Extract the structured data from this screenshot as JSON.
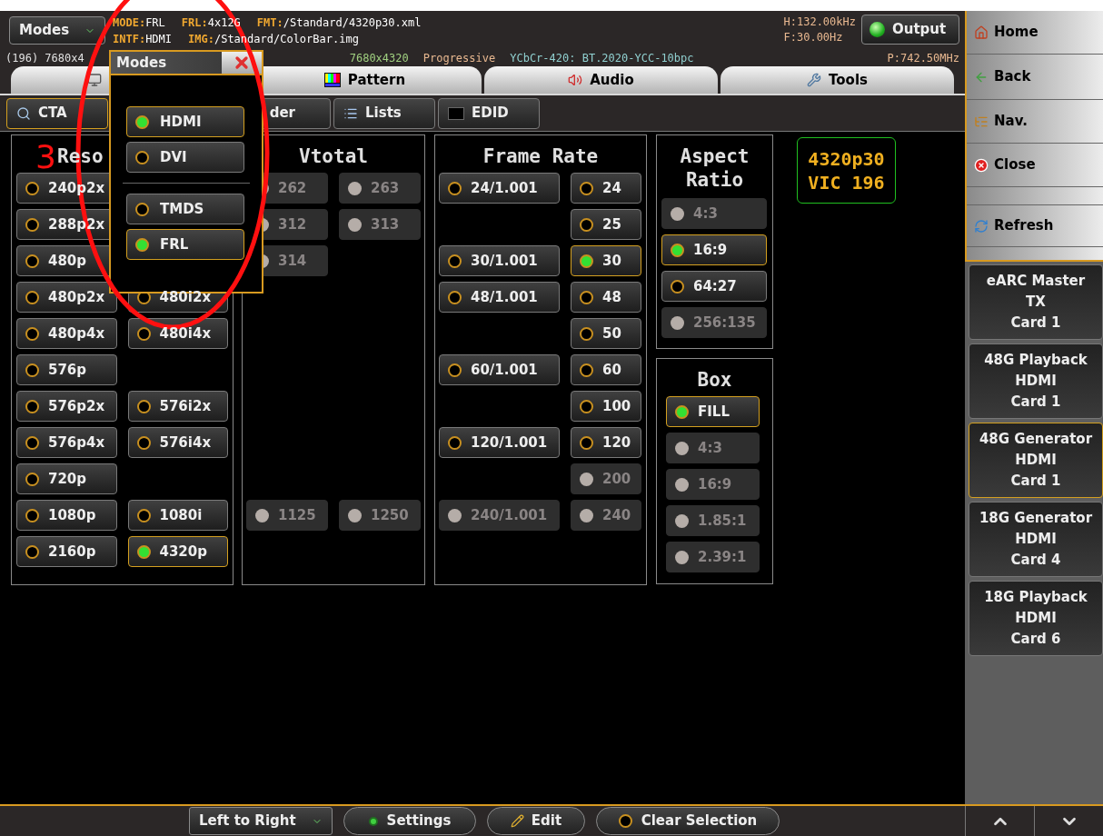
{
  "header": {
    "modes_button": "Modes",
    "info_lines": [
      [
        {
          "label": "MODE:",
          "value": "FRL"
        },
        {
          "label": "FRL:",
          "value": "4x12G"
        },
        {
          "label": "FMT:",
          "value": "/Standard/4320p30.xml"
        }
      ],
      [
        {
          "label": "INTF:",
          "value": "HDMI"
        },
        {
          "label": "IMG:",
          "value": "/Standard/ColorBar.img"
        }
      ]
    ],
    "timing": [
      "H:132.00kHz",
      "F:30.00Hz"
    ],
    "output_button": "Output",
    "mode_cut": "(196) 7680x4",
    "format_line": [
      {
        "text": "7680x4320",
        "color": "#a0d080"
      },
      {
        "text": "Progressive",
        "color": "#e8b890"
      },
      {
        "text": "YCbCr-420: BT.2020-YCC-10bpc",
        "color": "#90d0d0"
      }
    ],
    "pixel_clock": "P:742.50MHz"
  },
  "tabs": [
    {
      "kind": "display"
    },
    {
      "kind": "pattern",
      "label": "Pattern"
    },
    {
      "kind": "audio",
      "label": "Audio"
    },
    {
      "kind": "tools",
      "label": "Tools"
    }
  ],
  "subtabs": [
    {
      "kind": "cta",
      "label": "CTA",
      "selected": true
    },
    {
      "kind": "plain",
      "label": "der",
      "selected": false
    },
    {
      "kind": "lists",
      "label": "Lists",
      "selected": false
    },
    {
      "kind": "edid",
      "label": "EDID",
      "selected": false
    }
  ],
  "panels": [
    {
      "title": "Reso",
      "rows": [
        [
          {
            "label": "240p2x",
            "selected": false,
            "disabled": false
          },
          null
        ],
        [
          {
            "label": "288p2x",
            "selected": false,
            "disabled": false
          },
          null
        ],
        [
          {
            "label": "480p",
            "selected": false,
            "disabled": false
          },
          null
        ],
        [
          {
            "label": "480p2x",
            "selected": false,
            "disabled": false
          },
          {
            "label": "480i2x",
            "selected": false,
            "disabled": false
          }
        ],
        [
          {
            "label": "480p4x",
            "selected": false,
            "disabled": false
          },
          {
            "label": "480i4x",
            "selected": false,
            "disabled": false
          }
        ],
        [
          {
            "label": "576p",
            "selected": false,
            "disabled": false
          },
          null
        ],
        [
          {
            "label": "576p2x",
            "selected": false,
            "disabled": false
          },
          {
            "label": "576i2x",
            "selected": false,
            "disabled": false
          }
        ],
        [
          {
            "label": "576p4x",
            "selected": false,
            "disabled": false
          },
          {
            "label": "576i4x",
            "selected": false,
            "disabled": false
          }
        ],
        [
          {
            "label": "720p",
            "selected": false,
            "disabled": false
          },
          null
        ],
        [
          {
            "label": "1080p",
            "selected": false,
            "disabled": false
          },
          {
            "label": "1080i",
            "selected": false,
            "disabled": false
          }
        ],
        [
          {
            "label": "2160p",
            "selected": false,
            "disabled": false
          },
          {
            "label": "4320p",
            "selected": true,
            "disabled": false
          }
        ]
      ]
    },
    {
      "title": "Vtotal",
      "rows": [
        [
          {
            "label": "262",
            "selected": false,
            "disabled": true
          },
          {
            "label": "263",
            "selected": false,
            "disabled": true
          }
        ],
        [
          {
            "label": "312",
            "selected": false,
            "disabled": true
          },
          {
            "label": "313",
            "selected": false,
            "disabled": true
          }
        ],
        [
          {
            "label": "314",
            "selected": false,
            "disabled": true
          },
          null
        ],
        [
          null,
          null
        ],
        [
          null,
          null
        ],
        [
          null,
          null
        ],
        [
          null,
          null
        ],
        [
          null,
          null
        ],
        [
          null,
          null
        ],
        [
          {
            "label": "1125",
            "selected": false,
            "disabled": true
          },
          {
            "label": "1250",
            "selected": false,
            "disabled": true
          }
        ]
      ]
    },
    {
      "title": "Frame Rate",
      "rows": [
        [
          {
            "label": "24/1.001",
            "selected": false,
            "disabled": false
          },
          {
            "label": "24",
            "selected": false,
            "disabled": false
          }
        ],
        [
          null,
          {
            "label": "25",
            "selected": false,
            "disabled": false
          }
        ],
        [
          {
            "label": "30/1.001",
            "selected": false,
            "disabled": false
          },
          {
            "label": "30",
            "selected": true,
            "disabled": false
          }
        ],
        [
          {
            "label": "48/1.001",
            "selected": false,
            "disabled": false
          },
          {
            "label": "48",
            "selected": false,
            "disabled": false
          }
        ],
        [
          null,
          {
            "label": "50",
            "selected": false,
            "disabled": false
          }
        ],
        [
          {
            "label": "60/1.001",
            "selected": false,
            "disabled": false
          },
          {
            "label": "60",
            "selected": false,
            "disabled": false
          }
        ],
        [
          null,
          {
            "label": "100",
            "selected": false,
            "disabled": false
          }
        ],
        [
          {
            "label": "120/1.001",
            "selected": false,
            "disabled": false
          },
          {
            "label": "120",
            "selected": false,
            "disabled": false
          }
        ],
        [
          null,
          {
            "label": "200",
            "selected": false,
            "disabled": true
          }
        ],
        [
          {
            "label": "240/1.001",
            "selected": false,
            "disabled": true
          },
          {
            "label": "240",
            "selected": false,
            "disabled": true
          }
        ]
      ]
    },
    {
      "title": "Aspect Ratio",
      "rows": [
        [
          {
            "label": "4:3",
            "selected": false,
            "disabled": true
          }
        ],
        [
          {
            "label": "16:9",
            "selected": true,
            "disabled": false
          }
        ],
        [
          {
            "label": "64:27",
            "selected": false,
            "disabled": false
          }
        ],
        [
          {
            "label": "256:135",
            "selected": false,
            "disabled": true
          }
        ]
      ]
    },
    {
      "title": "Box",
      "rows": [
        [
          {
            "label": "FILL",
            "selected": true,
            "disabled": false
          }
        ],
        [
          {
            "label": "4:3",
            "selected": false,
            "disabled": true
          }
        ],
        [
          {
            "label": "16:9",
            "selected": false,
            "disabled": true
          }
        ],
        [
          {
            "label": "1.85:1",
            "selected": false,
            "disabled": true
          }
        ],
        [
          {
            "label": "2.39:1",
            "selected": false,
            "disabled": true
          }
        ]
      ]
    }
  ],
  "vic_badge": [
    "4320p30",
    "VIC 196"
  ],
  "modes_popup": {
    "title": "Modes",
    "groups": [
      [
        {
          "label": "HDMI",
          "selected": true
        },
        {
          "label": "DVI",
          "selected": false
        }
      ],
      [
        {
          "label": "TMDS",
          "selected": false
        },
        {
          "label": "FRL",
          "selected": true
        }
      ]
    ]
  },
  "annotation": {
    "label": "3"
  },
  "sidebar": {
    "nav": [
      {
        "kind": "home",
        "label": "Home"
      },
      {
        "kind": "back",
        "label": "Back"
      },
      {
        "kind": "nav",
        "label": "Nav."
      },
      {
        "kind": "close",
        "label": "Close"
      },
      {
        "kind": "refresh",
        "label": "Refresh"
      }
    ],
    "devices": [
      {
        "lines": [
          "eARC Master",
          "TX",
          "Card 1"
        ],
        "selected": false
      },
      {
        "lines": [
          "48G Playback",
          "HDMI",
          "Card 1"
        ],
        "selected": false
      },
      {
        "lines": [
          "48G Generator",
          "HDMI",
          "Card 1"
        ],
        "selected": true
      },
      {
        "lines": [
          "18G Generator",
          "HDMI",
          "Card 4"
        ],
        "selected": false
      },
      {
        "lines": [
          "18G Playback",
          "HDMI",
          "Card 6"
        ],
        "selected": false
      }
    ]
  },
  "bottom_bar": [
    {
      "kind": "dropdown",
      "label": "Left to Right"
    },
    {
      "kind": "settings",
      "label": "Settings"
    },
    {
      "kind": "edit",
      "label": "Edit"
    },
    {
      "kind": "clear",
      "label": "Clear Selection"
    }
  ]
}
